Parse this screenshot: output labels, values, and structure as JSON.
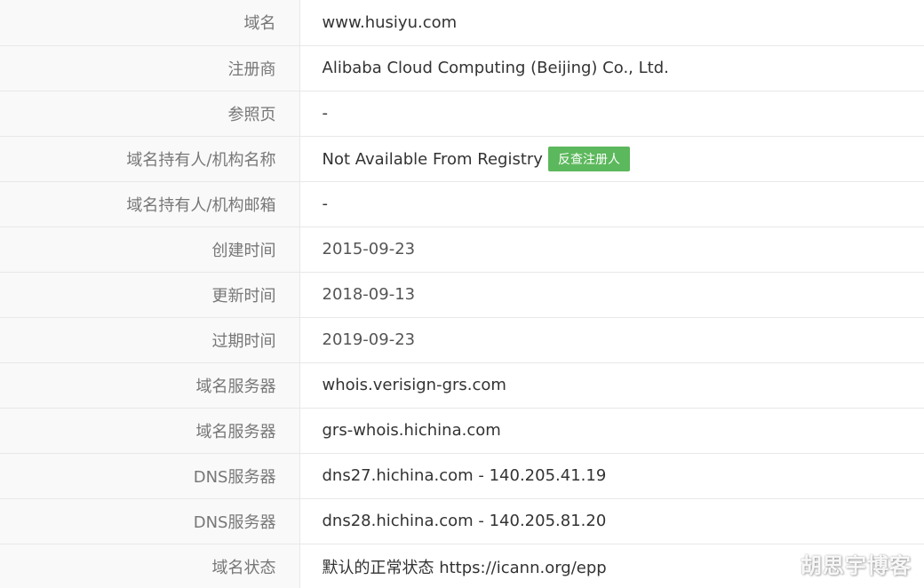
{
  "rows": [
    {
      "label": "域名",
      "value": "www.husiyu.com"
    },
    {
      "label": "注册商",
      "value": "Alibaba Cloud Computing (Beijing) Co., Ltd."
    },
    {
      "label": "参照页",
      "value": "-"
    },
    {
      "label": "域名持有人/机构名称",
      "value": "Not Available From Registry",
      "action_label": "反查注册人"
    },
    {
      "label": "域名持有人/机构邮箱",
      "value": "-"
    },
    {
      "label": "创建时间",
      "value": "2015-09-23"
    },
    {
      "label": "更新时间",
      "value": "2018-09-13"
    },
    {
      "label": "过期时间",
      "value": "2019-09-23"
    },
    {
      "label": "域名服务器",
      "value": "whois.verisign-grs.com"
    },
    {
      "label": "域名服务器",
      "value": "grs-whois.hichina.com"
    },
    {
      "label": "DNS服务器",
      "value": "dns27.hichina.com - 140.205.41.19"
    },
    {
      "label": "DNS服务器",
      "value": "dns28.hichina.com - 140.205.81.20"
    },
    {
      "label": "域名状态",
      "value": "默认的正常状态 https://icann.org/epp"
    }
  ],
  "watermark": "胡思宇博客",
  "colors": {
    "badge": "#5cb85c",
    "label_bg": "#f9f9f9",
    "border": "#e8e8e8"
  }
}
